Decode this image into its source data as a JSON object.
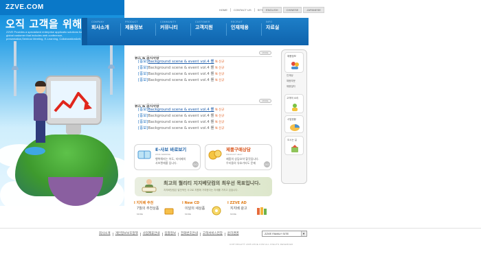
{
  "brand": {
    "logo": "ZZVE.COM"
  },
  "hero": {
    "title": "오직 고객을 위해",
    "subtitle": "ZZVE Provides a specialized enterprise applicatio solutions for global customer that includes web conference, presentation,Seminar Meeting, E-Learning, Collaboration&elt;"
  },
  "utility_links": [
    "HOME",
    "CONTACT US",
    "SITEMAP"
  ],
  "languages": [
    "ENGLISH",
    "CHINESE",
    "JAPANESE"
  ],
  "nav": [
    {
      "en": "COMPANY",
      "ko": "회사소개"
    },
    {
      "en": "PRODUCT",
      "ko": "제품정보"
    },
    {
      "en": "COMMUNITY",
      "ko": "커뮤니티"
    },
    {
      "en": "CUSTOMER",
      "ko": "고객지원"
    },
    {
      "en": "RECRUIT",
      "ko": "인재채용"
    },
    {
      "en": "INFO",
      "ko": "자료실"
    }
  ],
  "news_sections": [
    {
      "title": "뉴스 & 공지사항",
      "more": "MORE",
      "items": [
        {
          "tag": "[홍보]",
          "text": "Background scene & event vol.4 를",
          "new": "N 신규"
        },
        {
          "tag": "[홍보]",
          "text": "Background scene & event vol.4 를",
          "new": "N 신규"
        },
        {
          "tag": "[홍보]",
          "text": "Background scene & event vol.4 를",
          "new": "N 신규"
        },
        {
          "tag": "[홍보]",
          "text": "Background scene & event vol.4 를",
          "new": "N 신규"
        }
      ]
    },
    {
      "title": "뉴스 & 공지사항",
      "more": "MORE",
      "items": [
        {
          "tag": "[홍보]",
          "text": "Background scene & event vol.4 를",
          "new": "N 신규"
        },
        {
          "tag": "[홍보]",
          "text": "Background scene & event vol.4 를",
          "new": "N 신규"
        },
        {
          "tag": "[홍보]",
          "text": "Background scene & event vol.4 를",
          "new": "N 신규"
        },
        {
          "tag": "[홍보]",
          "text": "Background scene & event vol.4 를",
          "new": "N 신규"
        }
      ]
    }
  ],
  "promos": [
    {
      "title": "E-사보 바로보기",
      "sub": "ZZVE WEBZINE",
      "desc1": "행복해지는 어도, 지지베의",
      "desc2": "사보편재를 입니다.",
      "go": "GO"
    },
    {
      "title": "제품구매상담",
      "sub": "PRODUCT HELP",
      "desc1": "제품의 상담요약 할것입니다.",
      "desc2": "우리들의 유효기타도 문제",
      "go": "GO"
    }
  ],
  "banner": {
    "title": "최고의 퀄리티 지지베닷컴의 최우선 목표입니다.",
    "sub": "지지베닷컴은 발전적인 사고로 지원에 기여한다는 자세를 가지고 있습니다."
  },
  "minis": [
    {
      "title": "l 지지베 추천",
      "sub": "7월의 추천상품",
      "more": "MORE"
    },
    {
      "title": "l New CD",
      "sub": "이달의 새상품",
      "more": "MORE"
    },
    {
      "title": "l ZZVE AD",
      "sub": "지지베 광고",
      "more": "MORE"
    }
  ],
  "sidebar": {
    "top_label": "채용정보",
    "links": [
      "인재상",
      "채용부문",
      "채용절차"
    ],
    "cards": [
      "고객의 소리",
      "사업현황",
      "오시는 길"
    ]
  },
  "footer": {
    "links": [
      "회사소개",
      "개인정보보호정책",
      "사업제휴안내",
      "입찰정보",
      "전화번호안내",
      "고객서비스헌장",
      "윤리경영"
    ],
    "family_select": "ZZVE FAMILY SITE",
    "copyright": "COPYRIGHT© 2005 ZZVE.COM ALL RIGHTS RESERVED"
  },
  "colors": {
    "nav_blue": "#0f63ad",
    "hero_blue": "#0a78c8",
    "accent_orange": "#e07a14",
    "link_blue": "#1c6fc0"
  }
}
